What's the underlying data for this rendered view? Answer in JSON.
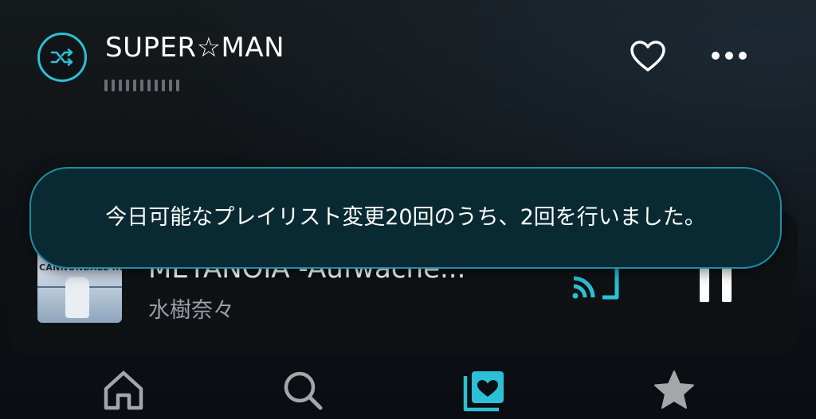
{
  "header": {
    "playlist_title": "SUPER☆MAN",
    "shuffle_icon": "shuffle-icon",
    "heart_icon": "heart-outline-icon",
    "more_icon": "more-horizontal-icon"
  },
  "toast": {
    "message": "今日可能なプレイリスト変更20回のうち、2回を行いました。"
  },
  "now_playing": {
    "title": "METANOIA -Aufwache...",
    "artist": "水樹奈々",
    "cover_text": "CANNONBALL RUNNING",
    "cast_icon": "cast-icon",
    "pause_icon": "pause-icon"
  },
  "bottom_nav": [
    {
      "icon": "home-icon"
    },
    {
      "icon": "search-icon"
    },
    {
      "icon": "library-heart-icon",
      "active": true
    },
    {
      "icon": "star-icon"
    }
  ],
  "colors": {
    "accent": "#2cc0d6",
    "toast_bg": "#0a2a33",
    "toast_border": "#1f8ea3",
    "inactive_icon": "#a3a7aa"
  }
}
